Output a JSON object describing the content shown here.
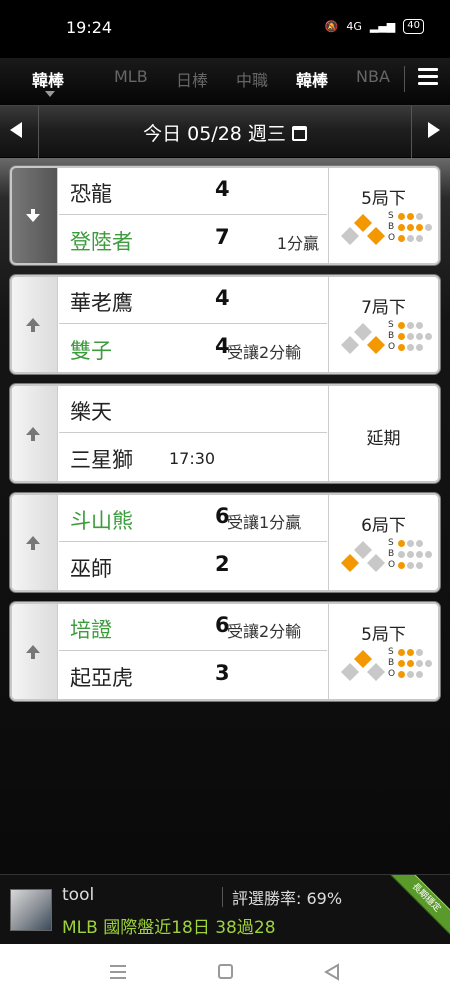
{
  "status_bar": {
    "time": "19:24",
    "battery": "40",
    "network": "4G"
  },
  "league_tabs": {
    "current": "韓棒",
    "items": [
      "MLB",
      "日棒",
      "中職",
      "韓棒",
      "NBA"
    ]
  },
  "date_bar": {
    "label": "今日 05/28 週三"
  },
  "games": [
    {
      "favorite": true,
      "away": {
        "name": "恐龍",
        "score": "4",
        "highlight": false
      },
      "home": {
        "name": "登陸者",
        "score": "7",
        "highlight": true,
        "note": "1分贏"
      },
      "status": "5局下",
      "bases": {
        "first": true,
        "second": true,
        "third": false
      },
      "count": {
        "strikes": 2,
        "balls": 3,
        "outs": 1
      }
    },
    {
      "favorite": false,
      "away": {
        "name": "華老鷹",
        "score": "4",
        "highlight": false
      },
      "home": {
        "name": "雙子",
        "score": "4",
        "highlight": true,
        "note": "受讓2分輸"
      },
      "status": "7局下",
      "bases": {
        "first": true,
        "second": false,
        "third": false
      },
      "count": {
        "strikes": 1,
        "balls": 1,
        "outs": 1
      }
    },
    {
      "favorite": false,
      "away": {
        "name": "樂天",
        "score": "",
        "highlight": false
      },
      "home": {
        "name": "三星獅",
        "score": "",
        "highlight": false,
        "time": "17:30"
      },
      "status": "延期"
    },
    {
      "favorite": false,
      "away": {
        "name": "斗山熊",
        "score": "6",
        "highlight": true,
        "note": "受讓1分贏"
      },
      "home": {
        "name": "巫師",
        "score": "2",
        "highlight": false
      },
      "status": "6局下",
      "bases": {
        "first": false,
        "second": false,
        "third": true
      },
      "count": {
        "strikes": 1,
        "balls": 0,
        "outs": 1
      }
    },
    {
      "favorite": false,
      "away": {
        "name": "培證",
        "score": "6",
        "highlight": true,
        "note": "受讓2分輸"
      },
      "home": {
        "name": "起亞虎",
        "score": "3",
        "highlight": false
      },
      "status": "5局下",
      "bases": {
        "first": false,
        "second": true,
        "third": false
      },
      "count": {
        "strikes": 2,
        "balls": 2,
        "outs": 1
      }
    }
  ],
  "banner": {
    "user": "tool",
    "win_rate": "評選勝率: 69%",
    "record": "MLB 國際盤近18日 38過28",
    "ribbon": "長期穩定"
  },
  "colors": {
    "accent_green": "#3c9b3c",
    "orange": "#f39800",
    "record_green": "#9fd33c"
  }
}
